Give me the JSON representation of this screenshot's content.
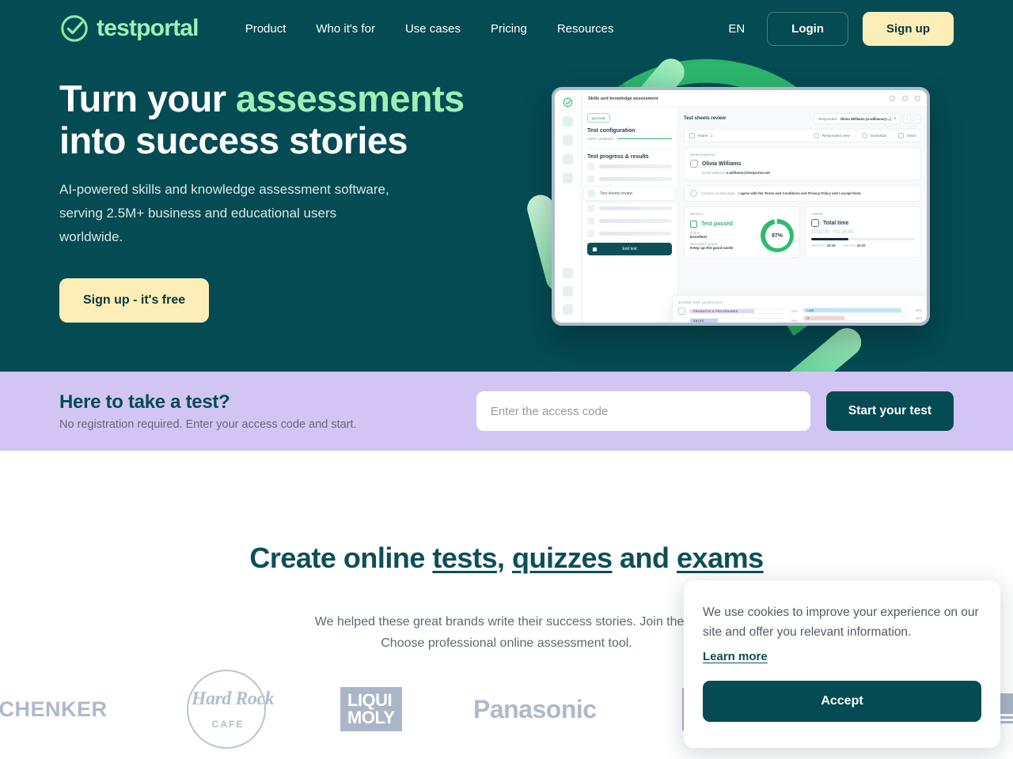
{
  "nav": {
    "logo_text": "testportal",
    "logo_icon": "circle-check-icon",
    "links": [
      {
        "label": "Product"
      },
      {
        "label": "Who it's for"
      },
      {
        "label": "Use cases"
      },
      {
        "label": "Pricing"
      },
      {
        "label": "Resources"
      }
    ],
    "language": "EN",
    "login_label": "Login",
    "signup_label": "Sign up"
  },
  "hero": {
    "heading_part1": "Turn your ",
    "heading_accent": "assessments",
    "heading_part2": "into success stories",
    "subtitle": "AI-powered skills and knowledge assessment software, serving 2.5M+ business and educational users worldwide.",
    "cta_label": "Sign up - it's free"
  },
  "mockup": {
    "window_title": "Skills and knowledge assessment",
    "status_badge": "ACTIVE",
    "config_title": "Test configuration",
    "config_progress": "100% completed",
    "progress_title": "Test progress & results",
    "selected_step": "Test sheets review",
    "end_test_label": "End test",
    "review_title": "Test sheets review",
    "respondent_label": "Respondent",
    "respondent_value": "Olivia Williams (o.williams@...)",
    "dates_label": "Dates",
    "dates_value": "1",
    "action_respondent_view": "Respondent view",
    "action_download": "Download",
    "action_send": "Send",
    "respondent_caps": "RESPONDENT",
    "respondent_name": "Olivia Williams",
    "email_label": "Email address",
    "email_value": "o.williams@testportal.net",
    "consent_label": "Consent on start page",
    "consent_value": "I agree with the Terms and Conditions and Privacy Policy and I accept them.",
    "result_caps": "RESULT",
    "result_status": "Test passed",
    "grade_label": "Grade",
    "grade_value": "Excellent",
    "desc_grade_label": "Descriptive grade",
    "desc_grade_value": "Keep up the good work!",
    "score_percent": "97%",
    "timer_caps": "TIMER",
    "timer_title": "Total time",
    "time_used": "00:32:05",
    "time_limit": "01:30:00",
    "start_time_label": "Start time",
    "start_time_value": "10:15",
    "end_time_label": "End time",
    "end_time_value": "10:47",
    "score_caps": "SCORE PER CATEGORY",
    "categories": [
      {
        "name": "PRODUCTS & PROCEDURES",
        "pct": "70%",
        "value": 70,
        "color": "#e3d6f7"
      },
      {
        "name": "SALES",
        "pct": "30%",
        "value": 30,
        "color": "#c8d3f0"
      },
      {
        "name": "LAW",
        "pct": "95%",
        "value": 95,
        "color": "#bfe6f7"
      },
      {
        "name": "IT",
        "pct": "40%",
        "value": 40,
        "color": "#f0d4d4"
      }
    ]
  },
  "access_bar": {
    "heading": "Here to take a test?",
    "subtitle": "No registration required. Enter your access code and start.",
    "input_placeholder": "Enter the access code",
    "input_value": "",
    "button_label": "Start your test"
  },
  "section": {
    "heading_prefix": "Create online ",
    "heading_link1": "tests",
    "heading_comma": ", ",
    "heading_link2": "quizzes",
    "heading_mid": " and ",
    "heading_link3": "exams",
    "paragraph_line1": "We helped these great brands write their success stories. Join them!",
    "paragraph_line2": "Choose professional online assessment tool."
  },
  "brands": [
    {
      "name": "SCHENKER",
      "display": "SCHENKER"
    },
    {
      "name": "Hard Rock Cafe",
      "top": "Hard Rock",
      "bottom": "CAFE"
    },
    {
      "name": "Liqui Moly",
      "line1": "LIQUI",
      "line2": "MOLY"
    },
    {
      "name": "Panasonic",
      "display": "Panasonic"
    }
  ],
  "cookie": {
    "message": "We use cookies to improve your experience on our site and offer you relevant information.",
    "link_label": "Learn more",
    "accept_label": "Accept"
  },
  "colors": {
    "dark_teal": "#044b53",
    "accent_green": "#9ef0b6",
    "cream": "#fdeeb8",
    "lavender": "#d2c5f4",
    "heading_teal": "#0d4f59",
    "brand_gray": "#aeb9cc"
  }
}
